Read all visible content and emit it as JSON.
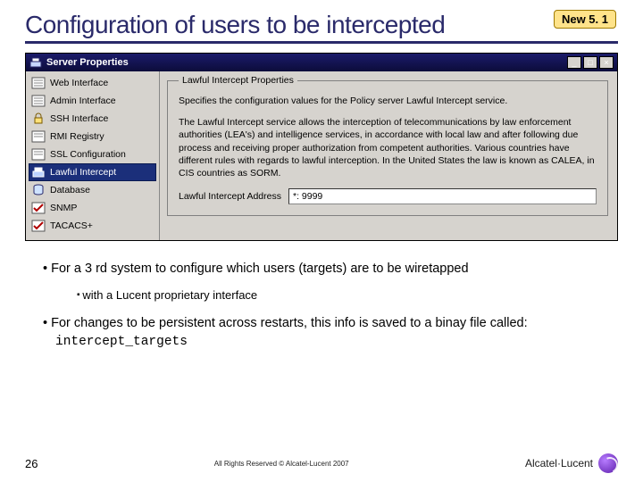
{
  "title": "Configuration of users to be intercepted",
  "badge": "New 5. 1",
  "window": {
    "title": "Server Properties",
    "buttons": {
      "min": "_",
      "max": "□",
      "close": "×"
    },
    "sidebar": [
      {
        "label": "Web Interface"
      },
      {
        "label": "Admin Interface"
      },
      {
        "label": "SSH Interface"
      },
      {
        "label": "RMI Registry"
      },
      {
        "label": "SSL Configuration"
      },
      {
        "label": "Lawful Intercept"
      },
      {
        "label": "Database"
      },
      {
        "label": "SNMP"
      },
      {
        "label": "TACACS+"
      }
    ],
    "group_legend": "Lawful Intercept Properties",
    "desc1": "Specifies the configuration values for the Policy server Lawful Intercept service.",
    "desc2": "The Lawful Intercept service allows the interception of telecommunications by law enforcement authorities (LEA's) and intelligence services, in accordance with local law and after following due process and receiving proper authorization from competent authorities. Various countries have different rules with regards to lawful interception. In the United States the law is known as CALEA, in CIS countries as SORM.",
    "field_label": "Lawful Intercept Address",
    "field_value": "*: 9999"
  },
  "bullets": {
    "b1a": "For a 3 rd system to configure which users (targets) are to be wiretapped",
    "b2a": "with a Lucent proprietary interface",
    "b1b_prefix": "For changes to be persistent across restarts, this info is saved to a binay file called: ",
    "b1b_code": "intercept_targets"
  },
  "footer": {
    "page": "26",
    "copyright": "All Rights Reserved © Alcatel-Lucent 2007",
    "brand": "Alcatel·Lucent"
  }
}
